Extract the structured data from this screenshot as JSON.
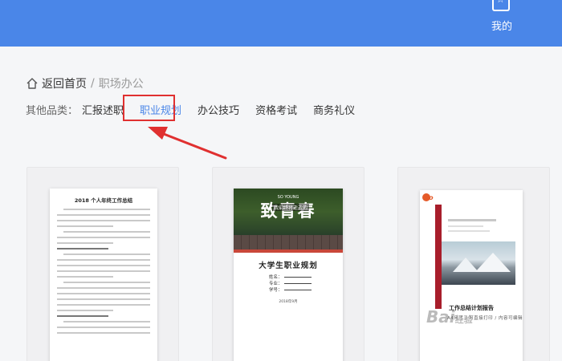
{
  "topbar": {
    "mine_label": "我的",
    "accent": "#4a86e8"
  },
  "breadcrumb": {
    "home": "返回首页",
    "separator": "/",
    "current": "职场办公"
  },
  "categories": {
    "label": "其他品类：",
    "items": [
      "汇报述职",
      "职业规划",
      "办公技巧",
      "资格考试",
      "商务礼仪"
    ],
    "active": "职业规划",
    "highlight_color": "#e03030"
  },
  "cards": [
    {
      "title": "2018 个人年终工作总结"
    },
    {
      "cover_text": "致青春",
      "cover_en": "SO YOUNG",
      "cover_overlay": "我们终将逝去的",
      "title": "大学生职业规划",
      "fields": [
        "姓名：",
        "专业：",
        "学号："
      ],
      "date": "2018年9月"
    },
    {
      "logo": "Lo",
      "title": "工作总结计划报告",
      "subtitle": "A4尺寸 / 可直接打印 / 内容可编辑"
    }
  ],
  "watermark": {
    "main": "Bai",
    "tail": "经验"
  }
}
